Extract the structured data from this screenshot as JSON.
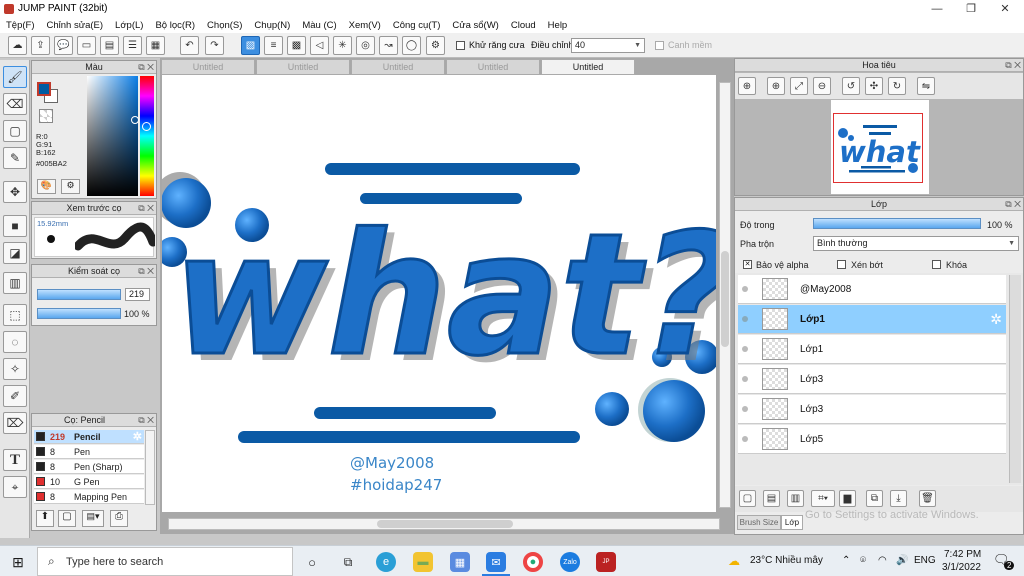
{
  "window": {
    "title": "JUMP PAINT (32bit)"
  },
  "menu": [
    "Tệp(F)",
    "Chỉnh sửa(E)",
    "Lớp(L)",
    "Bộ lọc(R)",
    "Chọn(S)",
    "Chụp(N)",
    "Màu (C)",
    "Xem(V)",
    "Công cụ(T)",
    "Cửa sổ(W)",
    "Cloud",
    "Help"
  ],
  "toolbar": {
    "antialias_label": "Khử răng cưa",
    "adjust_label": "Điều chỉnh",
    "adjust_value": "40",
    "snap_label": "Canh mềm"
  },
  "color_panel": {
    "title": "Màu",
    "r": "R:0",
    "g": "G:91",
    "b": "B:162",
    "hex": "#005BA2",
    "fg_color": "#005BA2",
    "bg_color": "#FFFFFF"
  },
  "brush_preview": {
    "title": "Xem trước cọ",
    "size": "15.92mm"
  },
  "brush_control": {
    "title": "Kiểm soát cọ",
    "size": "219",
    "opacity": "100 %",
    "opacity_value": 100
  },
  "brush_list": {
    "title": "Cọ: Pencil",
    "items": [
      {
        "size": "219",
        "name": "Pencil",
        "color": "#222222",
        "selected": true
      },
      {
        "size": "8",
        "name": "Pen",
        "color": "#222222",
        "selected": false
      },
      {
        "size": "8",
        "name": "Pen (Sharp)",
        "color": "#222222",
        "selected": false
      },
      {
        "size": "10",
        "name": "G Pen",
        "color": "#e03030",
        "selected": false
      },
      {
        "size": "8",
        "name": "Mapping Pen",
        "color": "#e03030",
        "selected": false
      }
    ]
  },
  "doc_tabs": [
    "Untitled",
    "Untitled",
    "Untitled",
    "Untitled",
    "Untitled"
  ],
  "canvas_art": {
    "word": "what?",
    "credit1": "@May2008",
    "credit2": "#hoidap247",
    "main_color": "#1d6fc7",
    "credit_color": "#3a86c8"
  },
  "navigator": {
    "title": "Hoa tiêu"
  },
  "layer_panel": {
    "title": "Lớp",
    "opacity_label": "Độ trong",
    "opacity_value": "100 %",
    "opacity_fraction": 1,
    "blend_label": "Pha trộn",
    "blend_value": "Bình thường",
    "protect_alpha": "Bảo vệ alpha",
    "clip": "Xén bớt",
    "lock": "Khóa",
    "layers": [
      {
        "name": "@May2008",
        "selected": false
      },
      {
        "name": "Lớp1",
        "selected": true
      },
      {
        "name": "Lớp1",
        "selected": false
      },
      {
        "name": "Lớp3",
        "selected": false
      },
      {
        "name": "Lớp3",
        "selected": false
      },
      {
        "name": "Lớp5",
        "selected": false
      }
    ],
    "tab_brush_size": "Brush Size",
    "tab_layer": "Lớp",
    "watermark": "Go to Settings to activate Windows."
  },
  "taskbar": {
    "search_placeholder": "Type here to search",
    "weather": "23°C  Nhiều mây",
    "lang": "ENG",
    "time": "7:42 PM",
    "date": "3/1/2022",
    "notif_count": "2"
  }
}
